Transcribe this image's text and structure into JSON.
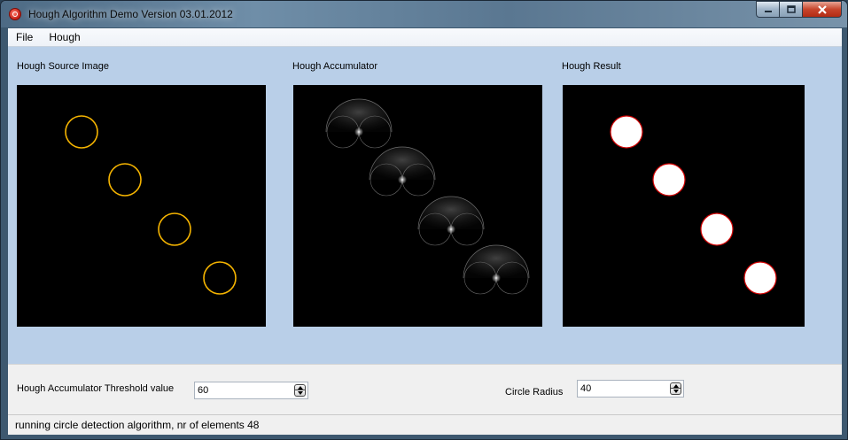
{
  "window": {
    "title": "Hough Algorithm Demo  Version  03.01.2012"
  },
  "menu": {
    "items": [
      "File",
      "Hough"
    ]
  },
  "panels": {
    "source": {
      "label": "Hough Source Image",
      "circle_color": "#f5b400"
    },
    "accumulator": {
      "label": "Hough Accumulator"
    },
    "result": {
      "label": "Hough Result",
      "fill_color": "#ffffff",
      "outline_color": "#d40000"
    }
  },
  "controls": {
    "threshold": {
      "label": "Hough Accumulator Threshold value",
      "value": "60"
    },
    "radius": {
      "label": "Circle Radius",
      "value": "40"
    }
  },
  "status": {
    "text": "running circle detection algorithm,  nr of elements  48"
  },
  "icons": {
    "app": "app-icon",
    "minimize": "minimize-icon",
    "maximize": "maximize-icon",
    "close": "close-icon",
    "spin_up": "arrow-up-icon",
    "spin_down": "arrow-down-icon"
  }
}
